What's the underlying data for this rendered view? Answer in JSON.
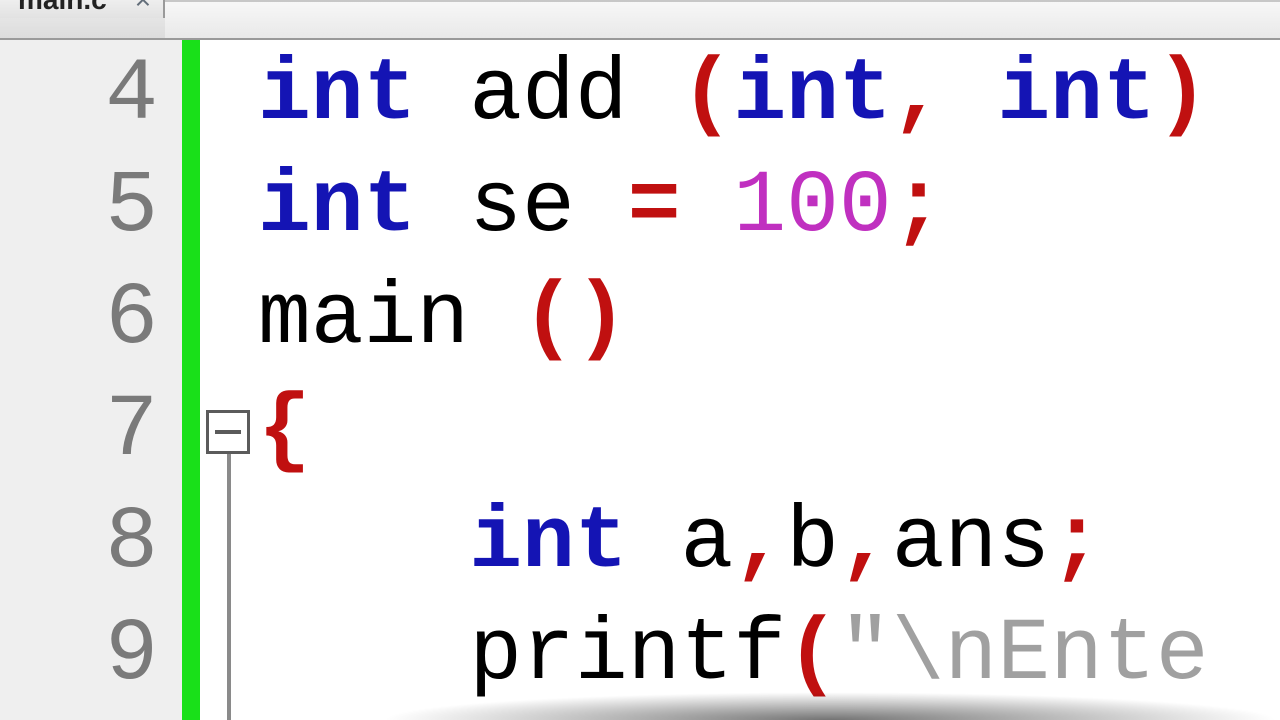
{
  "tab": {
    "filename": "main.c",
    "close_glyph": "×"
  },
  "gutter": {
    "start": 4,
    "count": 6
  },
  "fold": {
    "at_line_index": 3
  },
  "code": {
    "lines": [
      {
        "indent": 0,
        "tokens": [
          {
            "t": "kw",
            "v": "int"
          },
          {
            "t": "sp",
            "v": " "
          },
          {
            "t": "ident",
            "v": "add"
          },
          {
            "t": "sp",
            "v": " "
          },
          {
            "t": "paren",
            "v": "("
          },
          {
            "t": "kw",
            "v": "int"
          },
          {
            "t": "op",
            "v": ","
          },
          {
            "t": "sp",
            "v": " "
          },
          {
            "t": "kw",
            "v": "int"
          },
          {
            "t": "paren",
            "v": ")"
          }
        ]
      },
      {
        "indent": 0,
        "tokens": [
          {
            "t": "kw",
            "v": "int"
          },
          {
            "t": "sp",
            "v": " "
          },
          {
            "t": "ident",
            "v": "se"
          },
          {
            "t": "sp",
            "v": " "
          },
          {
            "t": "op",
            "v": "="
          },
          {
            "t": "sp",
            "v": " "
          },
          {
            "t": "num",
            "v": "100"
          },
          {
            "t": "op",
            "v": ";"
          }
        ]
      },
      {
        "indent": 0,
        "tokens": [
          {
            "t": "ident",
            "v": "main"
          },
          {
            "t": "sp",
            "v": " "
          },
          {
            "t": "paren",
            "v": "("
          },
          {
            "t": "paren",
            "v": ")"
          }
        ]
      },
      {
        "indent": 0,
        "tokens": [
          {
            "t": "paren",
            "v": "{"
          }
        ]
      },
      {
        "indent": 1,
        "tokens": [
          {
            "t": "kw",
            "v": "int"
          },
          {
            "t": "sp",
            "v": " "
          },
          {
            "t": "ident",
            "v": "a"
          },
          {
            "t": "op",
            "v": ","
          },
          {
            "t": "ident",
            "v": "b"
          },
          {
            "t": "op",
            "v": ","
          },
          {
            "t": "ident",
            "v": "ans"
          },
          {
            "t": "op",
            "v": ";"
          }
        ]
      },
      {
        "indent": 1,
        "tokens": [
          {
            "t": "ident",
            "v": "printf"
          },
          {
            "t": "paren",
            "v": "("
          },
          {
            "t": "str",
            "v": "\"\\nEnte"
          }
        ]
      }
    ],
    "indent_unit": "    "
  }
}
